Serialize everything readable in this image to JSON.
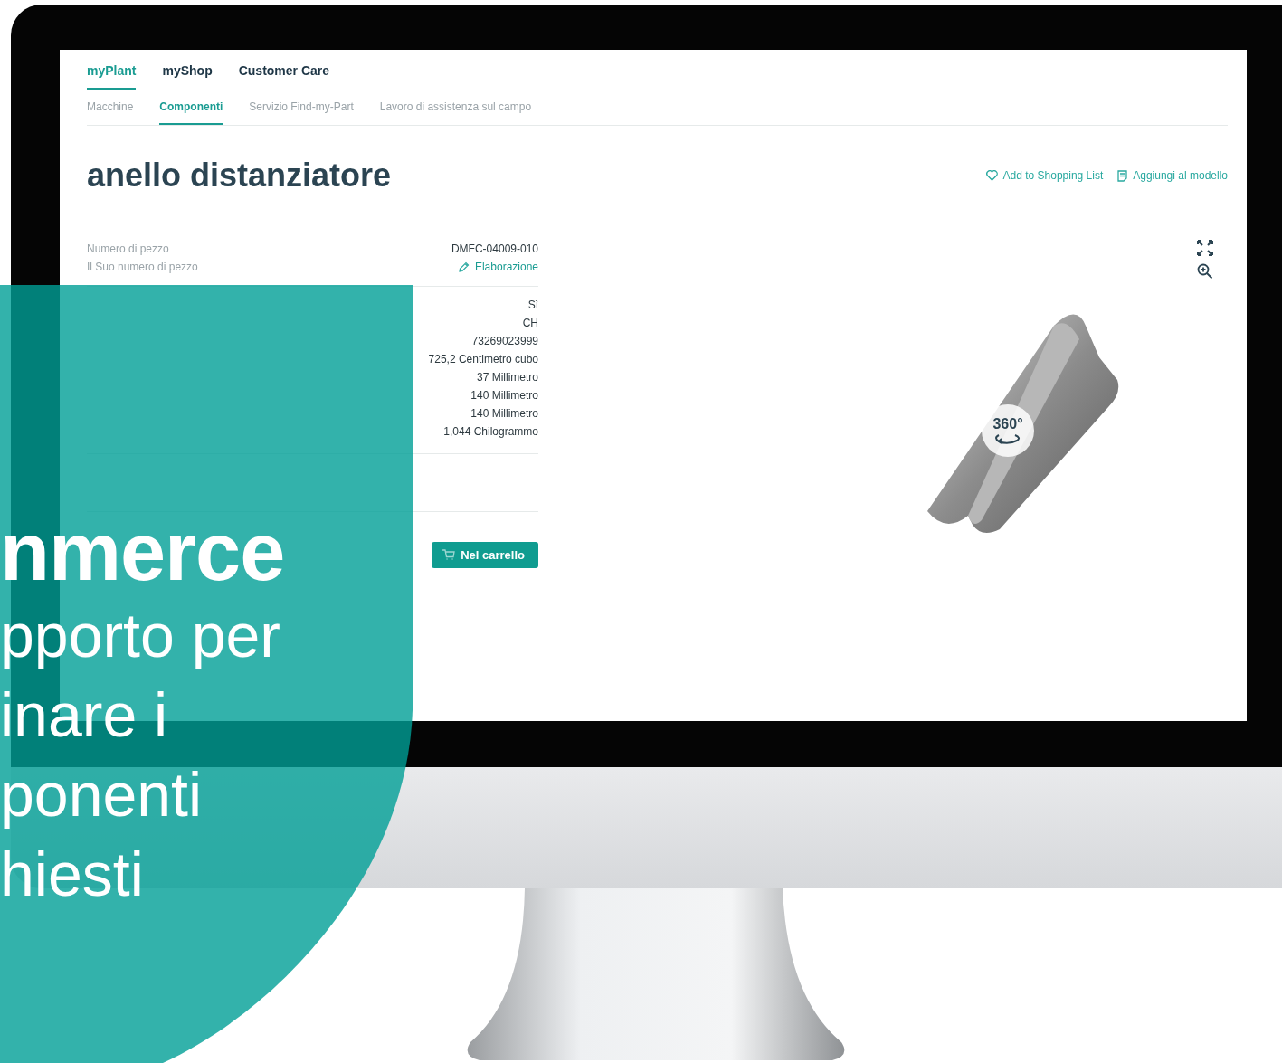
{
  "nav": {
    "tabs": [
      {
        "label": "myPlant",
        "selected": true
      },
      {
        "label": "myShop",
        "selected": false
      },
      {
        "label": "Customer Care",
        "selected": false
      }
    ]
  },
  "subnav": {
    "tabs": [
      {
        "label": "Macchine",
        "selected": false
      },
      {
        "label": "Componenti",
        "selected": true
      },
      {
        "label": "Servizio Find-my-Part",
        "selected": false
      },
      {
        "label": "Lavoro di assistenza sul campo",
        "selected": false
      }
    ]
  },
  "title": "anello distanziatore",
  "actions": [
    {
      "kind": "shopping_list",
      "label": "Add to Shopping List"
    },
    {
      "kind": "template",
      "label": "Aggiungi al modello"
    }
  ],
  "identity": [
    {
      "kind": "text",
      "label": "Numero di pezzo",
      "value": "DMFC-04009-010"
    },
    {
      "kind": "edit_link",
      "label": "Il Suo numero di pezzo",
      "value": "Elaborazione"
    }
  ],
  "attributes": [
    {
      "value": "Sì"
    },
    {
      "value": "CH"
    },
    {
      "value": "73269023999"
    },
    {
      "value": "725,2 Centimetro cubo"
    },
    {
      "value": "37 Millimetro"
    },
    {
      "value": "140 Millimetro"
    },
    {
      "value": "140 Millimetro"
    },
    {
      "value": "1,044 Chilogrammo"
    }
  ],
  "order": {
    "button": "Nel carrello"
  },
  "viewer": {
    "badge": "360°"
  },
  "overlay": {
    "lines": [
      {
        "kind": "headline",
        "text": "nmerce"
      },
      {
        "kind": "body",
        "text": "pporto per"
      },
      {
        "kind": "body",
        "text": "inare i"
      },
      {
        "kind": "body",
        "text": "ponenti"
      },
      {
        "kind": "body",
        "text": "hiesti"
      }
    ]
  }
}
